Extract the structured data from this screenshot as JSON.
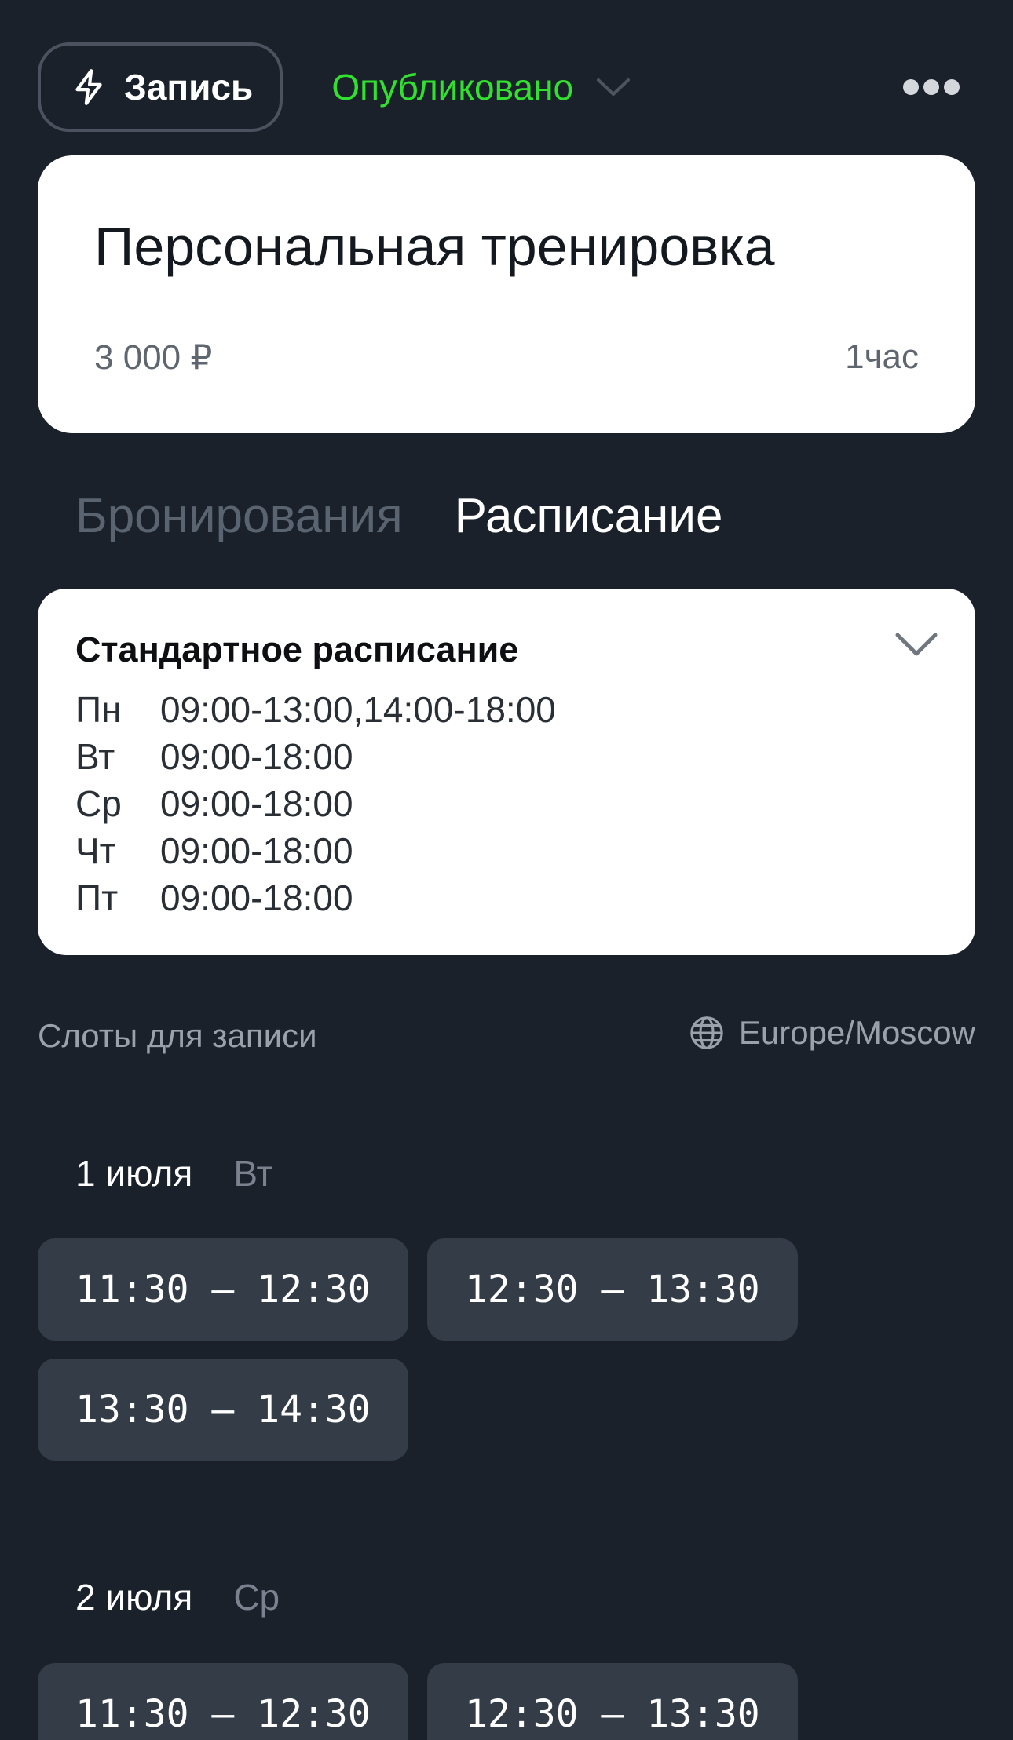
{
  "header": {
    "record_label": "Запись",
    "status_label": "Опубликовано",
    "status_color": "#32e12f",
    "icons": [
      "lightning-icon",
      "chevron-down-icon",
      "more-icon"
    ]
  },
  "service": {
    "title": "Персональная тренировка",
    "price": "3 000 ₽",
    "duration": "1час"
  },
  "tabs": [
    {
      "label": "Бронирования",
      "active": false
    },
    {
      "label": "Расписание",
      "active": true
    }
  ],
  "schedule": {
    "title": "Стандартное расписание",
    "rows": [
      {
        "day": "Пн",
        "hours": "09:00-13:00,14:00-18:00"
      },
      {
        "day": "Вт",
        "hours": "09:00-18:00"
      },
      {
        "day": "Ср",
        "hours": "09:00-18:00"
      },
      {
        "day": "Чт",
        "hours": "09:00-18:00"
      },
      {
        "day": "Пт",
        "hours": "09:00-18:00"
      }
    ]
  },
  "slots": {
    "label": "Слоты для записи",
    "timezone": "Europe/Moscow",
    "days": [
      {
        "date": "1 июля",
        "weekday": "Вт",
        "times": [
          "11:30 – 12:30",
          "12:30 – 13:30",
          "13:30 – 14:30"
        ]
      },
      {
        "date": "2 июля",
        "weekday": "Ср",
        "times": [
          "11:30 – 12:30",
          "12:30 – 13:30"
        ]
      }
    ]
  }
}
